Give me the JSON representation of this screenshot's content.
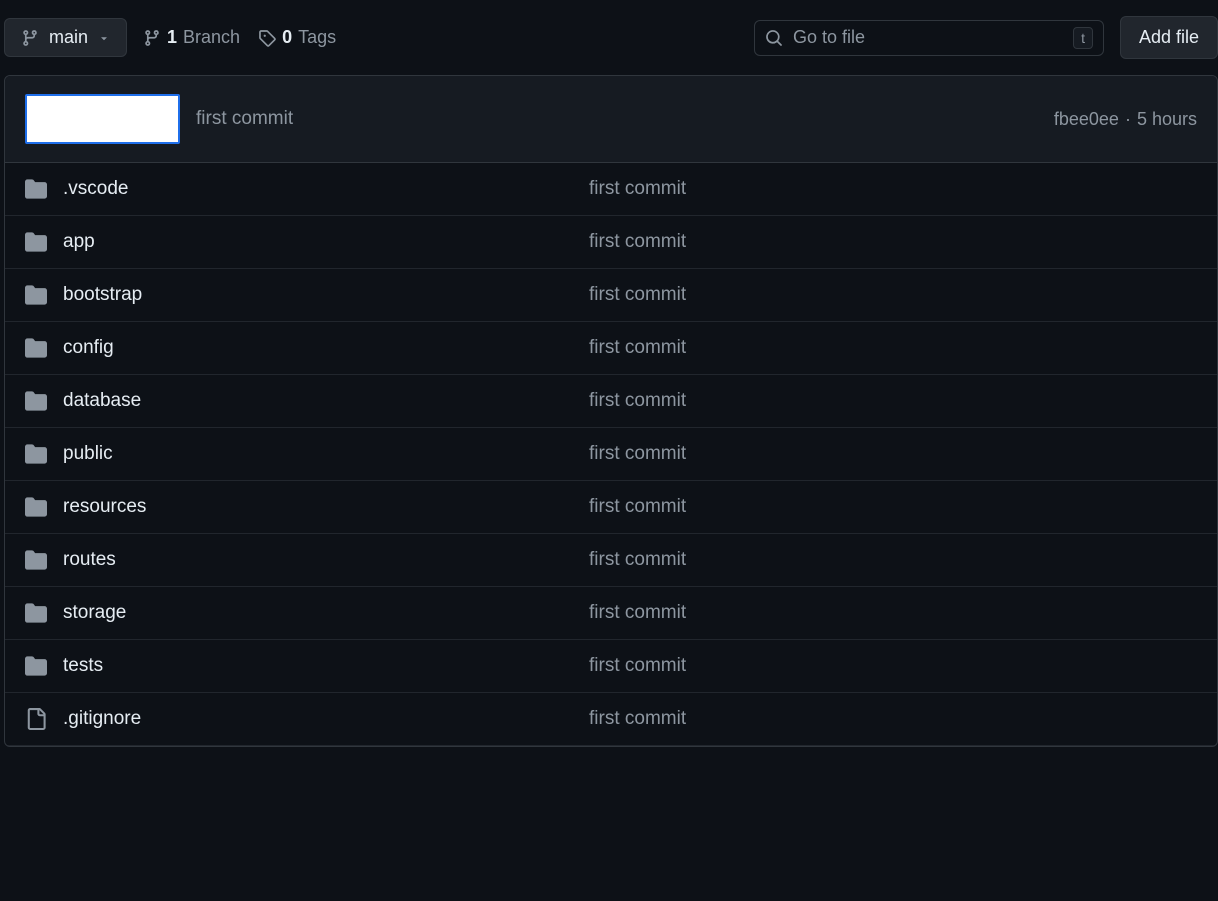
{
  "toolbar": {
    "branch_name": "main",
    "branch_count": "1",
    "branch_label": "Branch",
    "tag_count": "0",
    "tag_label": "Tags",
    "search_placeholder": "Go to file",
    "search_kbd": "t",
    "add_file_label": "Add file"
  },
  "commit_header": {
    "message": "first commit",
    "hash": "fbee0ee",
    "sep": "·",
    "time": "5 hours"
  },
  "files": [
    {
      "type": "dir",
      "name": ".vscode",
      "msg": "first commit"
    },
    {
      "type": "dir",
      "name": "app",
      "msg": "first commit"
    },
    {
      "type": "dir",
      "name": "bootstrap",
      "msg": "first commit"
    },
    {
      "type": "dir",
      "name": "config",
      "msg": "first commit"
    },
    {
      "type": "dir",
      "name": "database",
      "msg": "first commit"
    },
    {
      "type": "dir",
      "name": "public",
      "msg": "first commit"
    },
    {
      "type": "dir",
      "name": "resources",
      "msg": "first commit"
    },
    {
      "type": "dir",
      "name": "routes",
      "msg": "first commit"
    },
    {
      "type": "dir",
      "name": "storage",
      "msg": "first commit"
    },
    {
      "type": "dir",
      "name": "tests",
      "msg": "first commit"
    },
    {
      "type": "file",
      "name": ".gitignore",
      "msg": "first commit"
    }
  ]
}
